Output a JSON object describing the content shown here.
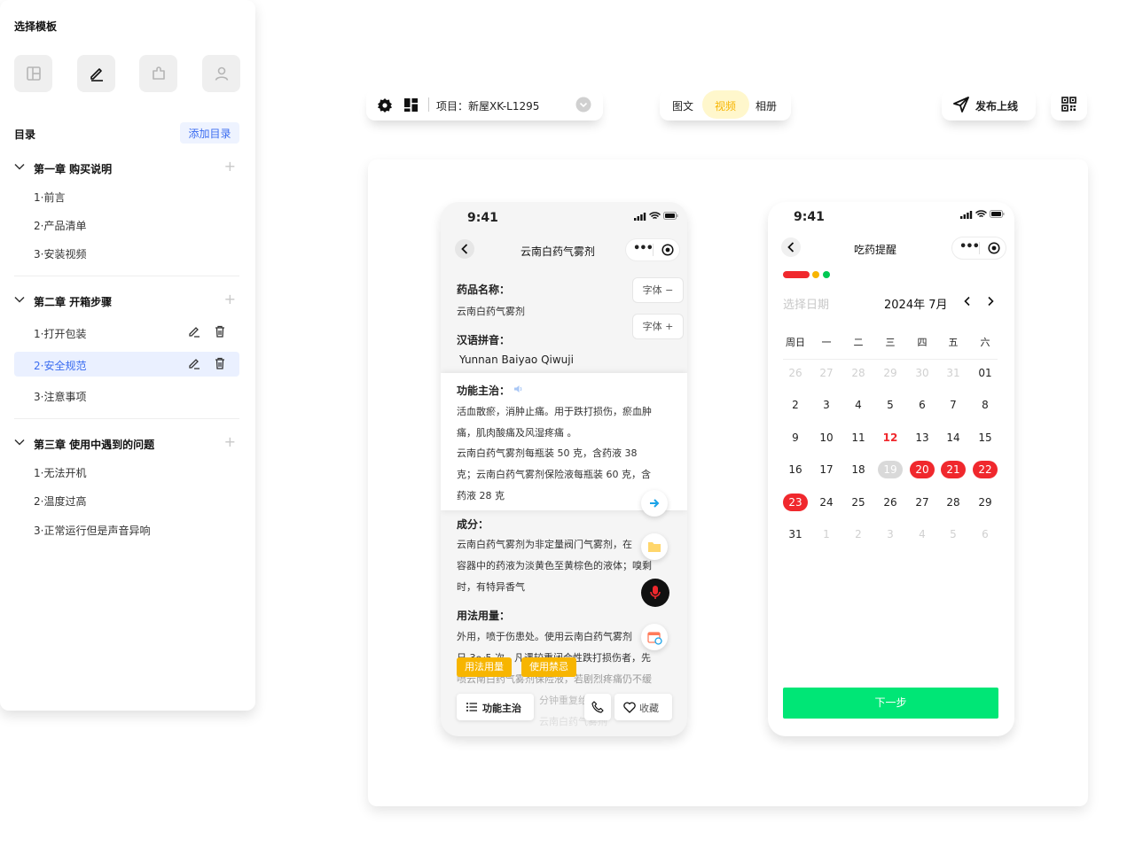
{
  "sidebar": {
    "title": "选择模板",
    "toc_label": "目录",
    "add_toc": "添加目录",
    "chapters": [
      {
        "title": "第一章 购买说明",
        "items": [
          "1·前言",
          "2·产品清单",
          "3·安装视频"
        ]
      },
      {
        "title": "第二章 开箱步骤",
        "items": [
          "1·打开包装",
          "2·安全规范",
          "3·注意事项"
        ]
      },
      {
        "title": "第三章 使用中遇到的问题",
        "items": [
          "1·无法开机",
          "2·温度过高",
          "3·正常运行但是声音异响"
        ]
      }
    ]
  },
  "toolbar": {
    "project": "项目：新屋XK-L1295",
    "tabs": [
      "图文",
      "视频",
      "相册"
    ],
    "active_tab": "视频",
    "publish": "发布上线"
  },
  "phone1": {
    "time": "9:41",
    "title": "云南白药气雾剂",
    "drug_label": "药品名称：",
    "drug_name": "云南白药气雾剂",
    "pinyin_label": "汉语拼音：",
    "pinyin": "Yunnan Baiyao Qiwuji",
    "font_minus": "字体 −",
    "font_plus": "字体 +",
    "func_label": "功能主治：",
    "func_lines": [
      "活血散瘀，消肿止痛。用于跌打损伤，瘀血肿",
      "痛，肌肉酸痛及风湿疼痛 。",
      "云南白药气雾剂每瓶装 50 克，含药液 38",
      "克；云南白药气雾剂保险液每瓶装 60 克，含",
      "药液 28 克"
    ],
    "comp_label": "成分：",
    "comp_lines": [
      "云南白药气雾剂为非定量阀门气雾剂，在",
      "容器中的药液为淡黄色至黄棕色的液体；嗅剩",
      "时，有特异香气"
    ],
    "usage_label": "用法用量：",
    "usage_lines": [
      "外用，喷于伤患处。使用云南白药气雾剂",
      "日 3～5 次，凡遇较重闭合性跌打损伤者，先",
      "喷云南白药气雾剂保险液，若剧烈疼痛仍不缓",
      "分钟重复给",
      "云南白药气雾剂"
    ],
    "tag1": "用法用量",
    "tag2": "使用禁忌",
    "nav_btn": "功能主治",
    "fav_btn": "收藏"
  },
  "phone2": {
    "time": "9:41",
    "title": "吃药提醒",
    "select_date": "选择日期",
    "month": "2024年 7月",
    "weekdays": [
      "周日",
      "一",
      "二",
      "三",
      "四",
      "五",
      "六"
    ],
    "days": [
      [
        "26",
        "27",
        "28",
        "29",
        "30",
        "31",
        "01"
      ],
      [
        "2",
        "3",
        "4",
        "5",
        "6",
        "7",
        "8"
      ],
      [
        "9",
        "10",
        "11",
        "12",
        "13",
        "14",
        "15"
      ],
      [
        "16",
        "17",
        "18",
        "19",
        "20",
        "21",
        "22"
      ],
      [
        "23",
        "24",
        "25",
        "26",
        "27",
        "28",
        "29"
      ],
      [
        "31",
        "1",
        "2",
        "3",
        "4",
        "5",
        "6"
      ]
    ],
    "next": "下一步"
  },
  "colors": {
    "accent": "#3b6cf0",
    "red": "#f0282d",
    "green": "#00e676",
    "orange": "#f7b500"
  }
}
